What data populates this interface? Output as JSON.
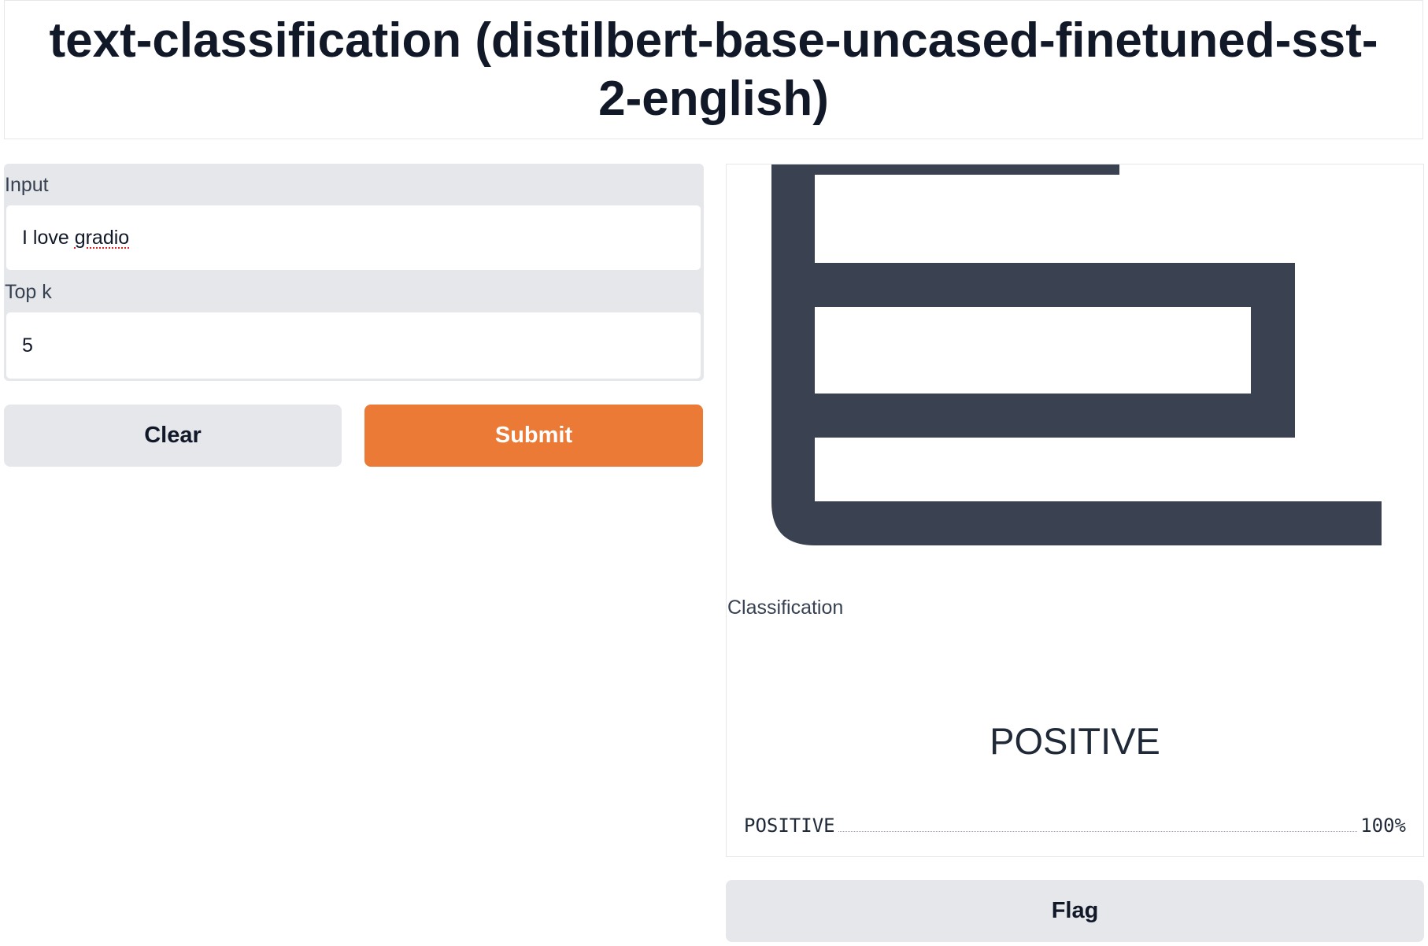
{
  "title": "text-classification (distilbert-base-uncased-finetuned-sst-2-english)",
  "inputs": {
    "input_label": "Input",
    "input_value_prefix": "I love ",
    "input_value_word": "gradio",
    "topk_label": "Top k",
    "topk_value": "5"
  },
  "buttons": {
    "clear": "Clear",
    "submit": "Submit",
    "flag": "Flag"
  },
  "output": {
    "label": "Classification",
    "predicted": "POSITIVE",
    "confidences": [
      {
        "label": "POSITIVE",
        "value": "100%"
      }
    ]
  },
  "colors": {
    "accent": "#ea7a35",
    "logo": "#3a4150"
  }
}
